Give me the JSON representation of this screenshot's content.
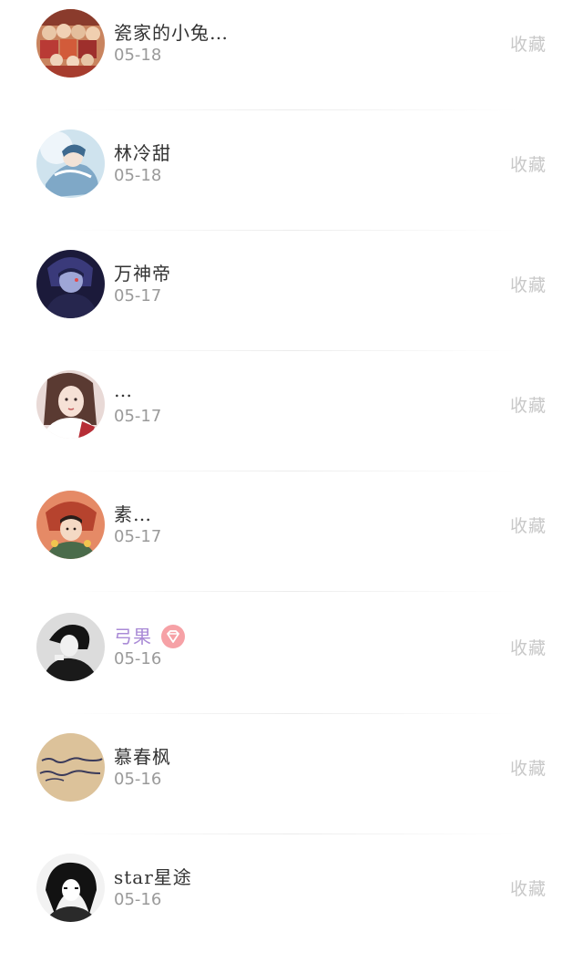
{
  "favorite_label": "收藏",
  "items": [
    {
      "name": "瓷家的小兔…",
      "date": "05-18",
      "avatar": "avatar-1",
      "vip": false
    },
    {
      "name": "林冷甜",
      "date": "05-18",
      "avatar": "avatar-2",
      "vip": false
    },
    {
      "name": "万神帝",
      "date": "05-17",
      "avatar": "avatar-3",
      "vip": false
    },
    {
      "name": "…",
      "date": "05-17",
      "avatar": "avatar-4",
      "vip": false
    },
    {
      "name": "素…",
      "date": "05-17",
      "avatar": "avatar-5",
      "vip": false
    },
    {
      "name": "弓果",
      "date": "05-16",
      "avatar": "avatar-6",
      "vip": true
    },
    {
      "name": "慕春枫",
      "date": "05-16",
      "avatar": "avatar-7",
      "vip": false
    },
    {
      "name": "star星途",
      "date": "05-16",
      "avatar": "avatar-8",
      "vip": false
    }
  ]
}
